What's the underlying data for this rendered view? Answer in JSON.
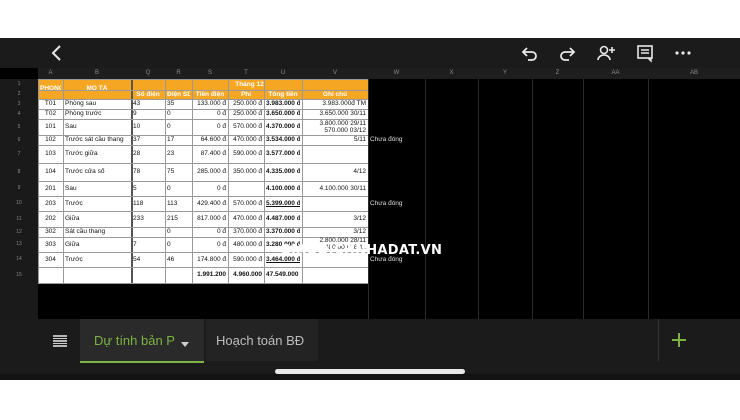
{
  "toolbar": {
    "back_icon": "chevron-left-icon",
    "undo_icon": "undo-icon",
    "redo_icon": "redo-icon",
    "add_person_icon": "add-person-icon",
    "comment_icon": "comment-icon",
    "more_icon": "more-dots-icon"
  },
  "columns": [
    "A",
    "B",
    "Q",
    "R",
    "S",
    "T",
    "U",
    "V",
    "W",
    "X",
    "Y",
    "Z",
    "AA",
    "AB"
  ],
  "rows": [
    "1",
    "2",
    "3",
    "4",
    "5",
    "6",
    "7",
    "8",
    "9",
    "10",
    "11",
    "12",
    "13",
    "14",
    "15"
  ],
  "headers": {
    "phong": "PHÒNG",
    "mota": "MÔ TẢ",
    "month": "Tháng 12",
    "so_dien": "Số điện",
    "dien_sd": "Điện SD",
    "tien_dien": "Tiền điện",
    "phi": "Phí",
    "tong_tien": "Tổng tiền",
    "ghi_chu": "Ghi chú"
  },
  "data_rows": [
    {
      "phong": "T01",
      "mota": "Phòng sau",
      "so": "43",
      "sd": "35",
      "tien": "133.000 đ",
      "phi": "250.000 đ",
      "tong": "3.983.000 đ",
      "ghi": "3.983.000đ TM",
      "note": ""
    },
    {
      "phong": "T02",
      "mota": "Phòng trước",
      "so": "9",
      "sd": "0",
      "tien": "0 đ",
      "phi": "250.000 đ",
      "tong": "3.650.000 đ",
      "ghi": "3.650.000 30/11",
      "note": ""
    },
    {
      "phong": "101",
      "mota": "Sau",
      "so": "10",
      "sd": "0",
      "tien": "0 đ",
      "phi": "570.000 đ",
      "tong": "4.370.000 đ",
      "ghi": "3.800.000 29/11",
      "ghi2": "570.000 03/12",
      "note": ""
    },
    {
      "phong": "102",
      "mota": "Trước sát cầu thang",
      "so": "37",
      "sd": "17",
      "tien": "64.600 đ",
      "phi": "470.000 đ",
      "tong": "3.534.000 đ",
      "ghi": "5/11",
      "note": "Chưa đóng"
    },
    {
      "phong": "103",
      "mota": "Trước giữa",
      "so": "28",
      "sd": "23",
      "tien": "87.400 đ",
      "phi": "590.000 đ",
      "tong": "3.577.000 đ",
      "ghi": "",
      "note": ""
    },
    {
      "phong": "104",
      "mota": "Trước cửa sổ",
      "so": "78",
      "sd": "75",
      "tien": "285.000 đ",
      "phi": "350.000 đ",
      "tong": "4.335.000 đ",
      "ghi": "4/12",
      "note": ""
    },
    {
      "phong": "201",
      "mota": "Sau",
      "so": "5",
      "sd": "0",
      "tien": "0 đ",
      "phi": "",
      "tong": "4.100.000 đ",
      "ghi": "4.100.000 30/11",
      "note": ""
    },
    {
      "phong": "203",
      "mota": "Trước",
      "so": "118",
      "sd": "113",
      "tien": "429.400 đ",
      "phi": "570.000 đ",
      "tong": "5.399.000 đ",
      "ghi": "",
      "note": "Chưa đóng"
    },
    {
      "phong": "202",
      "mota": "Giữa",
      "so": "233",
      "sd": "215",
      "tien": "817.000 đ",
      "phi": "470.000 đ",
      "tong": "4.487.000 đ",
      "ghi": "3/12",
      "note": ""
    },
    {
      "phong": "302",
      "mota": "Sát cầu thang",
      "so": "",
      "sd": "0",
      "tien": "0 đ",
      "phi": "370.000 đ",
      "tong": "3.370.000 đ",
      "ghi": "3/12",
      "note": ""
    },
    {
      "phong": "303",
      "mota": "Giữa",
      "so": "7",
      "sd": "0",
      "tien": "0 đ",
      "phi": "480.000 đ",
      "tong": "3.280.000 đ",
      "ghi": "2.800.000 28/11",
      "ghi2": "480.000 28/11",
      "note": ""
    },
    {
      "phong": "304",
      "mota": "Trước",
      "so": "54",
      "sd": "46",
      "tien": "174.800 đ",
      "phi": "590.000 đ",
      "tong": "3.464.000 đ",
      "ghi": "",
      "note": "Chưa đóng"
    }
  ],
  "totals": {
    "tien": "1.991.200",
    "phi": "4.960.000",
    "tong": "47.549.000 đ"
  },
  "watermark": "GIAODICHNHADAT.VN",
  "tabs": {
    "menu_icon": "hamburger-icon",
    "tab1_label": "Dự tính bản P",
    "tab2_label": "Hoạch toán BĐ",
    "add_icon": "plus-icon"
  },
  "colors": {
    "accent": "#f5a623",
    "tab_underline": "#7cb342",
    "plus": "#7cb342"
  }
}
